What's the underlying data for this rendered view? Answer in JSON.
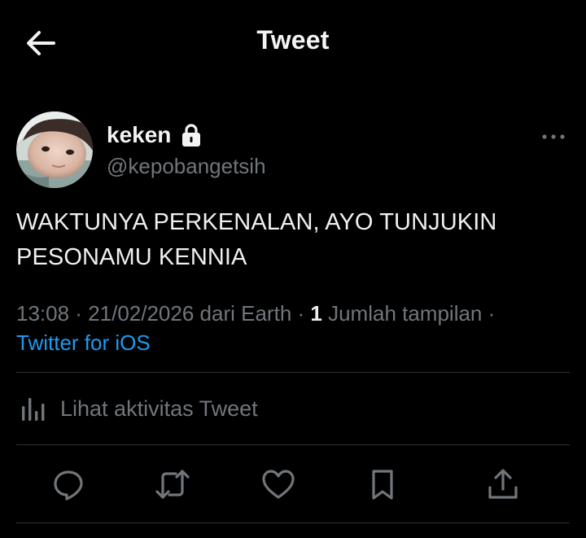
{
  "header": {
    "title": "Tweet",
    "back_icon": "arrow-left-icon"
  },
  "author": {
    "display_name": "keken",
    "handle": "@kepobangetsih",
    "protected_icon": "lock-icon",
    "more_icon": "more-horizontal-icon"
  },
  "tweet": {
    "text_line1": "WAKTUNYA PERKENALAN, AYO TUNJUKIN",
    "text_line2": "PESONAMU KENNIA"
  },
  "meta": {
    "time": "13:08",
    "sep1": " · ",
    "date": "21/02/2026",
    "location": " dari Earth",
    "sep2": " · ",
    "views_count": "1",
    "views_label": " Jumlah tampilan",
    "sep3": " ·",
    "source": "Twitter for iOS"
  },
  "activity": {
    "label": "Lihat aktivitas Tweet",
    "icon": "analytics-bars-icon"
  },
  "actions": [
    {
      "name": "reply",
      "icon": "reply-bubble-icon"
    },
    {
      "name": "retweet",
      "icon": "retweet-arrows-icon"
    },
    {
      "name": "like",
      "icon": "heart-icon"
    },
    {
      "name": "bookmark",
      "icon": "bookmark-icon"
    },
    {
      "name": "share",
      "icon": "share-upload-icon"
    }
  ],
  "colors": {
    "background": "#000000",
    "text_primary": "#e7e9ea",
    "text_secondary": "#71767b",
    "accent": "#1d9bf0",
    "divider": "#2f3336"
  }
}
